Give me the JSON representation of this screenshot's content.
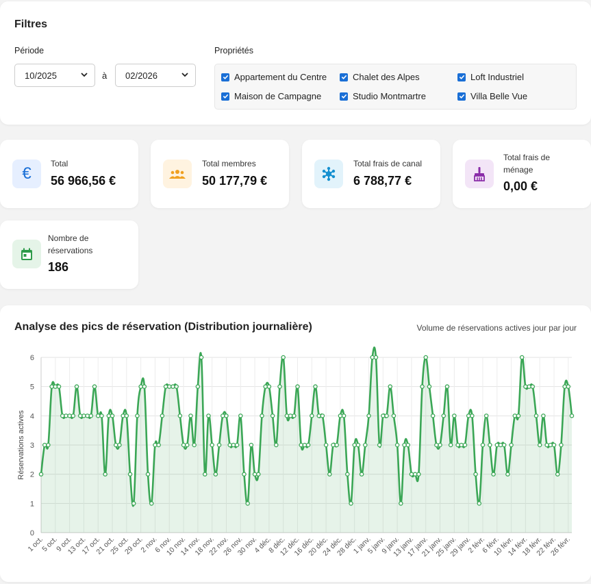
{
  "filters": {
    "title": "Filtres",
    "period_label": "Période",
    "from": "10/2025",
    "to_sep": "à",
    "to": "02/2026",
    "properties_label": "Propriétés",
    "properties": [
      {
        "label": "Appartement du Centre",
        "checked": true
      },
      {
        "label": "Chalet des Alpes",
        "checked": true
      },
      {
        "label": "Loft Industriel",
        "checked": true
      },
      {
        "label": "Maison de Campagne",
        "checked": true
      },
      {
        "label": "Studio Montmartre",
        "checked": true
      },
      {
        "label": "Villa Belle Vue",
        "checked": true
      }
    ]
  },
  "kpis": [
    {
      "label": "Total",
      "value": "56 966,56 €",
      "icon": "euro-icon",
      "color": "#1a6fd6",
      "bg": "#e6efff"
    },
    {
      "label": "Total membres",
      "value": "50 177,79 €",
      "icon": "group-icon",
      "color": "#f0a020",
      "bg": "#fff3e0"
    },
    {
      "label": "Total frais de canal",
      "value": "6 788,77 €",
      "icon": "hub-icon",
      "color": "#1590d0",
      "bg": "#e2f3fb"
    },
    {
      "label": "Total frais de ménage",
      "value": "0,00 €",
      "icon": "broom-icon",
      "color": "#8a2ca8",
      "bg": "#f3e5f7"
    },
    {
      "label": "Nombre de réservations",
      "value": "186",
      "icon": "calendar-icon",
      "color": "#2e9b4a",
      "bg": "#e5f4e8"
    }
  ],
  "chart": {
    "title": "Analyse des pics de réservation (Distribution journalière)",
    "subtitle": "Volume de réservations actives jour par jour"
  },
  "chart_data": {
    "type": "area",
    "ylabel": "Réservations actives",
    "ylim": [
      0,
      6
    ],
    "yticks": [
      0,
      1,
      2,
      3,
      4,
      5,
      6
    ],
    "x_tick_labels": [
      "1 oct.",
      "5 oct.",
      "9 oct.",
      "13 oct.",
      "17 oct.",
      "21 oct.",
      "25 oct.",
      "29 oct.",
      "2 nov.",
      "6 nov.",
      "10 nov.",
      "14 nov.",
      "18 nov.",
      "22 nov.",
      "26 nov.",
      "30 nov.",
      "4 déc.",
      "8 déc.",
      "12 déc.",
      "16 déc.",
      "20 déc.",
      "24 déc.",
      "28 déc.",
      "1 janv.",
      "5 janv.",
      "9 janv.",
      "13 janv.",
      "17 janv.",
      "21 janv.",
      "25 janv.",
      "29 janv.",
      "2 févr.",
      "6 févr.",
      "10 févr.",
      "14 févr.",
      "18 févr.",
      "22 févr.",
      "26 févr."
    ],
    "x_tick_every": 4,
    "grid": true,
    "color": "#3aa655",
    "values": [
      2,
      3,
      3,
      5,
      5,
      5,
      4,
      4,
      4,
      4,
      5,
      4,
      4,
      4,
      4,
      5,
      4,
      4,
      2,
      4,
      4,
      3,
      3,
      4,
      4,
      2,
      1,
      4,
      5,
      5,
      2,
      1,
      3,
      3,
      4,
      5,
      5,
      5,
      5,
      4,
      3,
      3,
      4,
      3,
      5,
      6,
      2,
      4,
      3,
      2,
      3,
      4,
      4,
      3,
      3,
      3,
      4,
      2,
      1,
      3,
      2,
      2,
      4,
      5,
      5,
      4,
      3,
      5,
      6,
      4,
      4,
      4,
      5,
      3,
      3,
      3,
      4,
      5,
      4,
      4,
      3,
      2,
      3,
      3,
      4,
      4,
      2,
      1,
      3,
      3,
      2,
      3,
      4,
      6,
      6,
      3,
      4,
      4,
      5,
      4,
      3,
      1,
      3,
      3,
      2,
      2,
      2,
      5,
      6,
      5,
      4,
      3,
      3,
      4,
      5,
      3,
      4,
      3,
      3,
      3,
      4,
      4,
      2,
      1,
      3,
      4,
      3,
      2,
      3,
      3,
      3,
      2,
      3,
      4,
      4,
      6,
      5,
      5,
      5,
      4,
      3,
      4,
      3,
      3,
      3,
      2,
      3,
      5,
      5,
      4
    ]
  }
}
